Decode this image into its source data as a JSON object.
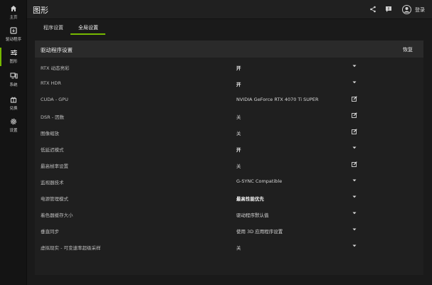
{
  "sidebar": {
    "items": [
      {
        "label": "主页",
        "icon": "home-icon"
      },
      {
        "label": "驱动程序",
        "icon": "driver-icon"
      },
      {
        "label": "图形",
        "icon": "sliders-icon"
      },
      {
        "label": "系统",
        "icon": "monitor-icon"
      },
      {
        "label": "兑换",
        "icon": "gift-icon"
      },
      {
        "label": "设置",
        "icon": "gear-icon"
      }
    ]
  },
  "header": {
    "title": "图形",
    "login": "登录"
  },
  "tabs": [
    {
      "label": "程序设置"
    },
    {
      "label": "全局设置",
      "active": true
    }
  ],
  "panel": {
    "title": "驱动程序设置",
    "restore": "恢复",
    "rows": [
      {
        "name": "RTX 动态亮彩",
        "value": "开",
        "control": "dropdown"
      },
      {
        "name": "RTX HDR",
        "value": "开",
        "control": "dropdown"
      },
      {
        "name": "CUDA - GPU",
        "value": "NVIDIA GeForce RTX 4070 Ti SUPER",
        "control": "edit"
      },
      {
        "name": "DSR - 因数",
        "value": "关",
        "control": "edit"
      },
      {
        "name": "图像缩放",
        "value": "关",
        "control": "edit"
      },
      {
        "name": "低延迟模式",
        "value": "开",
        "control": "dropdown"
      },
      {
        "name": "最高帧率设置",
        "value": "关",
        "control": "edit"
      },
      {
        "name": "监视器技术",
        "value": "G-SYNC Compatible",
        "control": "dropdown"
      },
      {
        "name": "电源管理模式",
        "value": "最高性能优先",
        "control": "dropdown"
      },
      {
        "name": "着色器缓存大小",
        "value": "驱动程序默认值",
        "control": "dropdown"
      },
      {
        "name": "垂直同步",
        "value": "使用 3D 应用程序设置",
        "control": "dropdown"
      },
      {
        "name": "虚拟现实 - 可变速率超级采样",
        "value": "关",
        "control": "dropdown"
      }
    ]
  },
  "colors": {
    "accent": "#76b900",
    "background": "#1a1a1a",
    "panel": "#1f1f1f",
    "panel_header": "#2a2a2a"
  }
}
